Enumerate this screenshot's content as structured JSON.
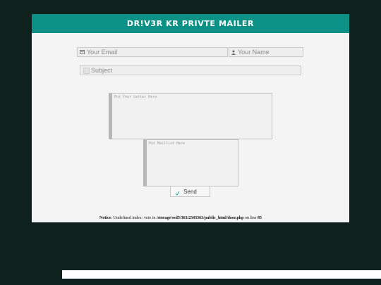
{
  "header": {
    "title": "DR!V3R KR PRIVTE MAILER"
  },
  "form": {
    "email_placeholder": "Your Email",
    "name_placeholder": "Your Name",
    "subject_placeholder": "Subject",
    "letter_placeholder": "Put Your Letter Here",
    "maillist_placeholder": "Put Maillist Here",
    "send_label": "Send"
  },
  "notice": {
    "label": "Notice",
    "text_before": ": Undefined index: veio in ",
    "path": "/storage/ssd5/363/2343363/public_html/door.php",
    "text_after": " on line ",
    "line": "85"
  },
  "colors": {
    "background": "#0e211c",
    "header": "#0b9186",
    "panel": "#f4f4f4"
  },
  "icons": {
    "email": "envelope-icon",
    "name": "user-icon",
    "send": "loading-icon"
  }
}
